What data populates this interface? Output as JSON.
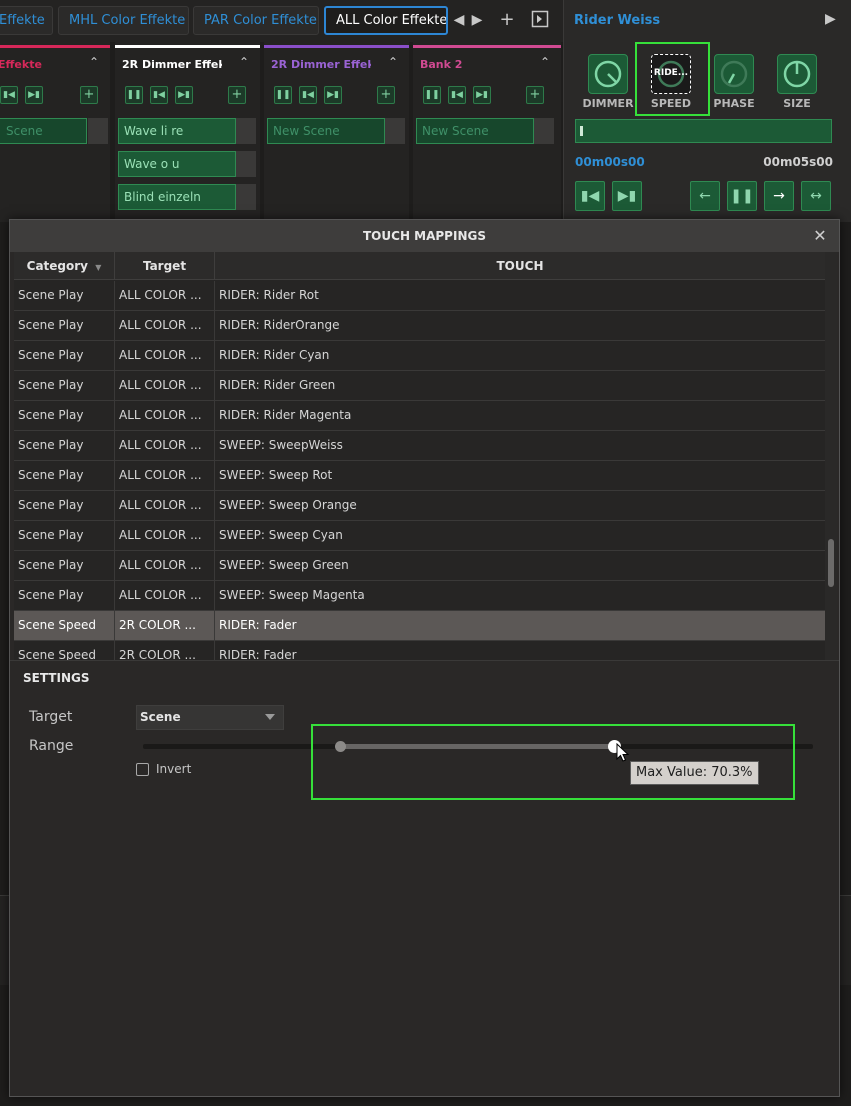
{
  "tabs": [
    {
      "label": "Effekte",
      "active": false
    },
    {
      "label": "MHL Color Effekte",
      "active": false
    },
    {
      "label": "PAR Color Effekte",
      "active": false
    },
    {
      "label": "ALL Color Effekte",
      "active": true
    }
  ],
  "columns": [
    {
      "title": "Effekte",
      "bar_color": "#d7285a",
      "title_color": "#d7285a",
      "scenes": [
        {
          "label": "Scene",
          "placeholder": true
        }
      ]
    },
    {
      "title": "2R Dimmer Effekte",
      "bar_color": "#ffffff",
      "title_color": "#ffffff",
      "scenes": [
        {
          "label": "Wave li re",
          "placeholder": false
        },
        {
          "label": "Wave o u",
          "placeholder": false
        },
        {
          "label": "Blind einzeln",
          "placeholder": false
        }
      ]
    },
    {
      "title": "2R Dimmer Effek...",
      "bar_color": "#8a4fc9",
      "title_color": "#9a63d4",
      "scenes": [
        {
          "label": "New Scene",
          "placeholder": true
        }
      ]
    },
    {
      "title": "Bank 2",
      "bar_color": "#d04a92",
      "title_color": "#d04a92",
      "scenes": [
        {
          "label": "New Scene",
          "placeholder": true
        }
      ]
    }
  ],
  "right_panel": {
    "title": "Rider Weiss",
    "knobs": [
      "DIMMER",
      "SPEED",
      "PHASE",
      "SIZE"
    ],
    "speed_knob_text": "RIDE...",
    "time_start": "00m00s00",
    "time_end": "00m05s00"
  },
  "dialog": {
    "title": "TOUCH MAPPINGS",
    "columns": [
      "Category",
      "Target",
      "TOUCH"
    ],
    "rows": [
      {
        "category": "Scene Play",
        "target": "ALL COLOR ...",
        "touch": "RIDER: Rider Rot",
        "selected": false
      },
      {
        "category": "Scene Play",
        "target": "ALL COLOR ...",
        "touch": "RIDER: RiderOrange",
        "selected": false
      },
      {
        "category": "Scene Play",
        "target": "ALL COLOR ...",
        "touch": "RIDER: Rider Cyan",
        "selected": false
      },
      {
        "category": "Scene Play",
        "target": "ALL COLOR ...",
        "touch": "RIDER: Rider Green",
        "selected": false
      },
      {
        "category": "Scene Play",
        "target": "ALL COLOR ...",
        "touch": "RIDER: Rider Magenta",
        "selected": false
      },
      {
        "category": "Scene Play",
        "target": "ALL COLOR ...",
        "touch": "SWEEP: SweepWeiss",
        "selected": false
      },
      {
        "category": "Scene Play",
        "target": "ALL COLOR ...",
        "touch": "SWEEP: Sweep Rot",
        "selected": false
      },
      {
        "category": "Scene Play",
        "target": "ALL COLOR ...",
        "touch": "SWEEP: Sweep Orange",
        "selected": false
      },
      {
        "category": "Scene Play",
        "target": "ALL COLOR ...",
        "touch": "SWEEP: Sweep Cyan",
        "selected": false
      },
      {
        "category": "Scene Play",
        "target": "ALL COLOR ...",
        "touch": "SWEEP: Sweep Green",
        "selected": false
      },
      {
        "category": "Scene Play",
        "target": "ALL COLOR ...",
        "touch": "SWEEP: Sweep Magenta",
        "selected": false
      },
      {
        "category": "Scene Speed",
        "target": "2R COLOR ...",
        "touch": "RIDER: Fader",
        "selected": true
      },
      {
        "category": "Scene Speed",
        "target": "2R COLOR ...",
        "touch": "RIDER: Fader",
        "selected": false
      }
    ],
    "settings": {
      "heading": "SETTINGS",
      "target_label": "Target",
      "target_value": "Scene",
      "range_label": "Range",
      "range_min_fraction": 0.294,
      "range_max_fraction": 0.703,
      "invert_label": "Invert",
      "invert_checked": false,
      "tooltip": "Max Value: 70.3%"
    }
  },
  "colors": {
    "accent_blue": "#2d86d4",
    "scene_green": "#1c5a36",
    "highlight_green": "#36e03a"
  }
}
